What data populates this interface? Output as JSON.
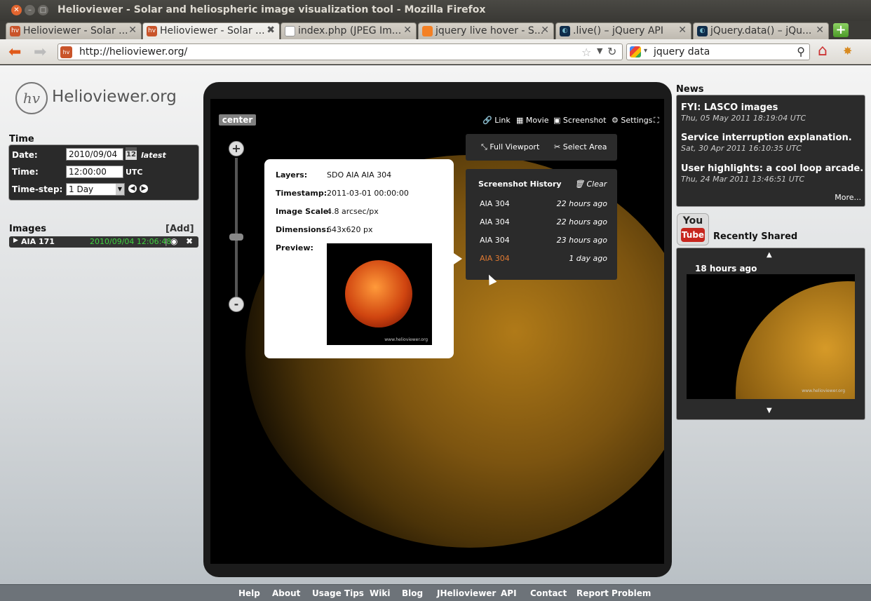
{
  "browser": {
    "title": "Helioviewer - Solar and heliospheric image visualization tool - Mozilla Firefox",
    "tabs": [
      {
        "label": "Helioviewer - Solar ...",
        "icon": "hv"
      },
      {
        "label": "Helioviewer - Solar ...",
        "icon": "hv"
      },
      {
        "label": "index.php (JPEG Im...",
        "icon": "page"
      },
      {
        "label": "jquery live hover - S...",
        "icon": "stackoverflow"
      },
      {
        "label": ".live() – jQuery API",
        "icon": "jquery"
      },
      {
        "label": "jQuery.data() – jQu...",
        "icon": "jquery"
      }
    ],
    "url": "http://helioviewer.org/",
    "search": "jquery data"
  },
  "logo": {
    "mark": "hv",
    "name": "Helioviewer.org"
  },
  "time": {
    "heading": "Time",
    "date_label": "Date:",
    "date_value": "2010/09/04",
    "latest": "latest",
    "time_label": "Time:",
    "time_value": "12:00:00",
    "utc": "UTC",
    "timestep_label": "Time-step:",
    "timestep_value": "1 Day",
    "calendar_day": "12"
  },
  "images": {
    "heading": "Images",
    "add": "[Add]",
    "layer": {
      "name": "AIA 171",
      "datetime": "2010/09/04 12:06:48"
    }
  },
  "viewport": {
    "center": "center",
    "menu": {
      "link": "Link",
      "movie": "Movie",
      "screenshot": "Screenshot",
      "settings": "Settings"
    },
    "full_viewport": "Full Viewport",
    "select_area": "Select Area",
    "zoom_in": "+",
    "zoom_out": "-"
  },
  "history": {
    "title": "Screenshot History",
    "clear": "Clear",
    "items": [
      {
        "label": "AIA 304",
        "time": "22 hours ago"
      },
      {
        "label": "AIA 304",
        "time": "22 hours ago"
      },
      {
        "label": "AIA 304",
        "time": "23 hours ago"
      },
      {
        "label": "AIA 304",
        "time": "1 day ago"
      }
    ]
  },
  "popup": {
    "layers_label": "Layers:",
    "layers": "SDO AIA AIA 304",
    "timestamp_label": "Timestamp:",
    "timestamp": "2011-03-01 00:00:00",
    "scale_label": "Image Scale:",
    "scale": "4.8 arcsec/px",
    "dimensions_label": "Dimensions:",
    "dimensions": "643x620 px",
    "preview_label": "Preview:",
    "watermark": "www.helioviewer.org"
  },
  "news": {
    "heading": "News",
    "items": [
      {
        "title": "FYI: LASCO images",
        "date": "Thu, 05 May 2011 18:19:04 UTC"
      },
      {
        "title": "Service interruption explanation.",
        "date": "Sat, 30 Apr 2011 16:10:35 UTC"
      },
      {
        "title": "User highlights: a cool loop arcade.",
        "date": "Thu, 24 Mar 2011 13:46:51 UTC"
      }
    ],
    "more": "More..."
  },
  "youtube": {
    "you": "You",
    "tube": "Tube"
  },
  "shared": {
    "heading": "Recently Shared",
    "time": "18 hours ago",
    "watermark": "www.helioviewer.org"
  },
  "footer": [
    "Help",
    "About",
    "Usage Tips",
    "Wiki",
    "Blog",
    "JHelioviewer",
    "API",
    "Contact",
    "Report Problem"
  ]
}
